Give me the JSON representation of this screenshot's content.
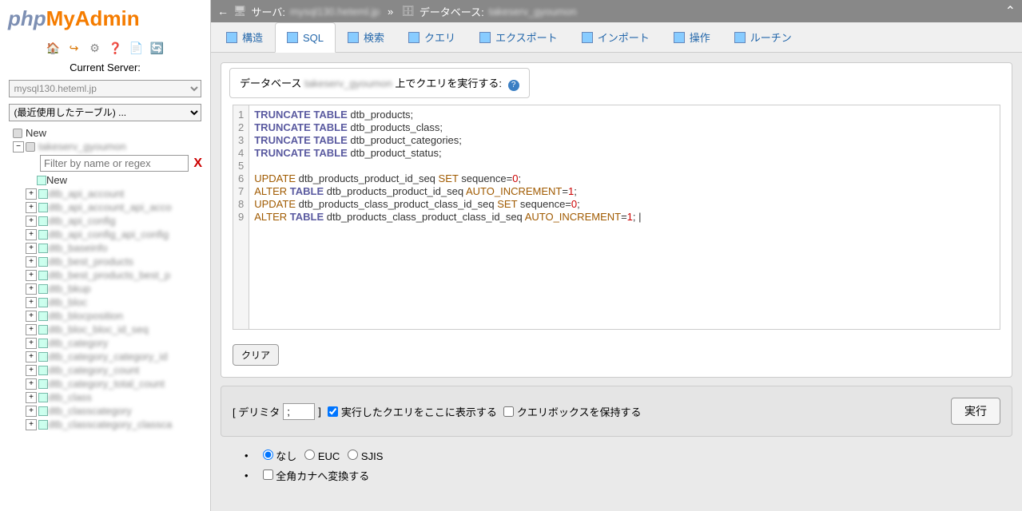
{
  "logo": {
    "php": "php",
    "my": "My",
    "admin": "Admin"
  },
  "sidebar": {
    "server_label": "Current Server:",
    "server_value": "mysql130.heteml.jp",
    "recent": "(最近使用したテーブル) ...",
    "new": "New",
    "db_name": "takeserv_gyoumon",
    "filter_placeholder": "Filter by name or regex",
    "filter_x": "X",
    "tables": [
      "New",
      "dtb_api_account",
      "dtb_api_account_api_acco",
      "dtb_api_config",
      "dtb_api_config_api_config",
      "dtb_baseinfo",
      "dtb_best_products",
      "dtb_best_products_best_p",
      "dtb_bkup",
      "dtb_bloc",
      "dtb_blocposition",
      "dtb_bloc_bloc_id_seq",
      "dtb_category",
      "dtb_category_category_id",
      "dtb_category_count",
      "dtb_category_total_count",
      "dtb_class",
      "dtb_classcategory",
      "dtb_classcategory_classca"
    ]
  },
  "topbar": {
    "server_lbl": "サーバ:",
    "server_val": "mysql130.heteml.jp",
    "db_lbl": "データベース:",
    "db_val": "takeserv_gyoumon"
  },
  "tabs": [
    "構造",
    "SQL",
    "検索",
    "クエリ",
    "エクスポート",
    "インポート",
    "操作",
    "ルーチン"
  ],
  "active_tab": 1,
  "panel": {
    "prefix": "データベース ",
    "dbname": "takeserv_gyoumon",
    "suffix": " 上でクエリを実行する:"
  },
  "sql_lines": [
    [
      [
        "kw",
        "TRUNCATE"
      ],
      [
        "sp",
        " "
      ],
      [
        "kw",
        "TABLE"
      ],
      [
        "sp",
        " "
      ],
      [
        "ident",
        "dtb_products;"
      ]
    ],
    [
      [
        "kw",
        "TRUNCATE"
      ],
      [
        "sp",
        " "
      ],
      [
        "kw",
        "TABLE"
      ],
      [
        "sp",
        " "
      ],
      [
        "ident",
        "dtb_products_class;"
      ]
    ],
    [
      [
        "kw",
        "TRUNCATE"
      ],
      [
        "sp",
        " "
      ],
      [
        "kw",
        "TABLE"
      ],
      [
        "sp",
        " "
      ],
      [
        "ident",
        "dtb_product_categories;"
      ]
    ],
    [
      [
        "kw",
        "TRUNCATE"
      ],
      [
        "sp",
        " "
      ],
      [
        "kw",
        "TABLE"
      ],
      [
        "sp",
        " "
      ],
      [
        "ident",
        "dtb_product_status;"
      ]
    ],
    [],
    [
      [
        "kw2",
        "UPDATE"
      ],
      [
        "sp",
        " "
      ],
      [
        "ident",
        "dtb_products_product_id_seq "
      ],
      [
        "kw2",
        "SET"
      ],
      [
        "sp",
        " "
      ],
      [
        "ident",
        "sequence="
      ],
      [
        "num",
        "0"
      ],
      [
        "ident",
        ";"
      ]
    ],
    [
      [
        "kw2",
        "ALTER"
      ],
      [
        "sp",
        " "
      ],
      [
        "kw",
        "TABLE"
      ],
      [
        "sp",
        " "
      ],
      [
        "ident",
        "dtb_products_product_id_seq "
      ],
      [
        "kw2",
        "AUTO_INCREMENT"
      ],
      [
        "ident",
        "="
      ],
      [
        "num",
        "1"
      ],
      [
        "ident",
        ";"
      ]
    ],
    [
      [
        "kw2",
        "UPDATE"
      ],
      [
        "sp",
        " "
      ],
      [
        "ident",
        "dtb_products_class_product_class_id_seq "
      ],
      [
        "kw2",
        "SET"
      ],
      [
        "sp",
        " "
      ],
      [
        "ident",
        "sequence="
      ],
      [
        "num",
        "0"
      ],
      [
        "ident",
        ";"
      ]
    ],
    [
      [
        "kw2",
        "ALTER"
      ],
      [
        "sp",
        " "
      ],
      [
        "kw",
        "TABLE"
      ],
      [
        "sp",
        " "
      ],
      [
        "ident",
        "dtb_products_class_product_class_id_seq "
      ],
      [
        "kw2",
        "AUTO_INCREMENT"
      ],
      [
        "ident",
        "="
      ],
      [
        "num",
        "1"
      ],
      [
        "ident",
        "; |"
      ]
    ]
  ],
  "clear": "クリア",
  "options": {
    "delim_lbl_open": "[ デリミタ",
    "delim_val": ";",
    "delim_lbl_close": "]",
    "show_here": "実行したクエリをここに表示する",
    "keep_box": "クエリボックスを保持する",
    "execute": "実行"
  },
  "radios": {
    "none": "なし",
    "euc": "EUC",
    "sjis": "SJIS",
    "kana": "全角カナへ変換する"
  }
}
